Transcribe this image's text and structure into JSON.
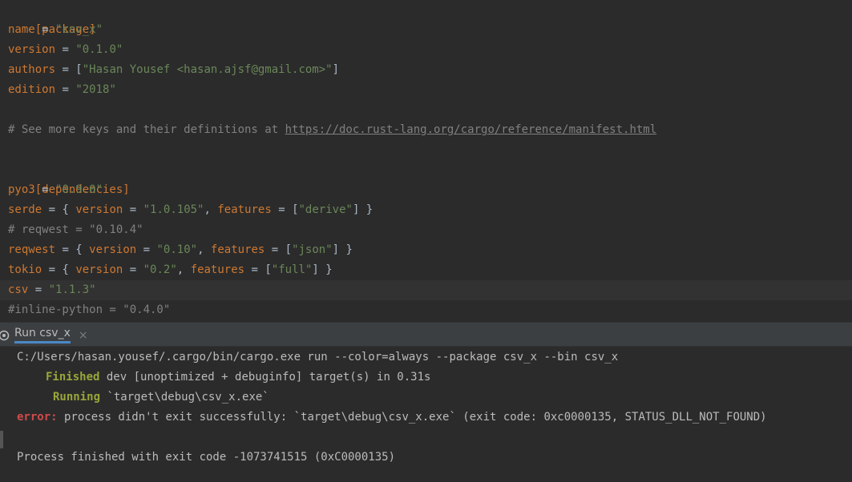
{
  "editor": {
    "lines": {
      "l1": {
        "text": "[package]"
      },
      "l2": {
        "key": "name",
        "eq": " = ",
        "val": "\"csv_x\""
      },
      "l3": {
        "key": "version",
        "eq": " = ",
        "val": "\"0.1.0\""
      },
      "l4": {
        "key": "authors",
        "eq": " = [",
        "val": "\"Hasan Yousef <hasan.ajsf@gmail.com>\"",
        "end": "]"
      },
      "l5": {
        "key": "edition",
        "eq": " = ",
        "val": "\"2018\""
      },
      "l7": {
        "text": "# See more keys and their definitions at ",
        "link": "https://doc.rust-lang.org/cargo/reference/manifest.html"
      },
      "l9": {
        "text": "[dependencies]"
      },
      "l10": {
        "key": "pyo3",
        "eq": " = ",
        "val": "\"0.9.0\""
      },
      "l11": {
        "key": "serde",
        "p1": " = { ",
        "k2": "version",
        "p2": " = ",
        "v2": "\"1.0.105\"",
        "p3": ", ",
        "k3": "features",
        "p4": " = [",
        "v3": "\"derive\"",
        "p5": "] }"
      },
      "l12": {
        "text": "# reqwest = \"0.10.4\""
      },
      "l13": {
        "key": "reqwest",
        "p1": " = { ",
        "k2": "version",
        "p2": " = ",
        "v2": "\"0.10\"",
        "p3": ", ",
        "k3": "features",
        "p4": " = [",
        "v3": "\"json\"",
        "p5": "] }"
      },
      "l14": {
        "key": "tokio",
        "p1": " = { ",
        "k2": "version",
        "p2": " = ",
        "v2": "\"0.2\"",
        "p3": ", ",
        "k3": "features",
        "p4": " = [",
        "v3": "\"full\"",
        "p5": "] }"
      },
      "l15": {
        "key": "csv",
        "eq": " = ",
        "val": "\"1.1.3\""
      },
      "l16": {
        "text": "#inline-python = \"0.4.0\""
      }
    }
  },
  "run_panel": {
    "tab_label": "Run csv_x",
    "close_glyph": "×",
    "icon": "run-config-icon"
  },
  "console": {
    "cmd": "C:/Users/hasan.yousef/.cargo/bin/cargo.exe run --color=always --package csv_x --bin csv_x",
    "finished_word": "Finished",
    "finished_rest": " dev [unoptimized + debuginfo] target(s) in 0.31s",
    "running_word": "Running",
    "running_rest": " `target\\debug\\csv_x.exe`",
    "error_word": "error:",
    "error_rest": " process didn't exit successfully: `target\\debug\\csv_x.exe` (exit code: 0xc0000135, STATUS_DLL_NOT_FOUND)",
    "exit_msg": "Process finished with exit code -1073741515 (0xC0000135)"
  },
  "colors": {
    "background": "#2b2b2b",
    "keyword": "#cc7832",
    "string": "#6a8759",
    "comment": "#808080",
    "success": "#99a63a",
    "error": "#cf4b4b"
  }
}
